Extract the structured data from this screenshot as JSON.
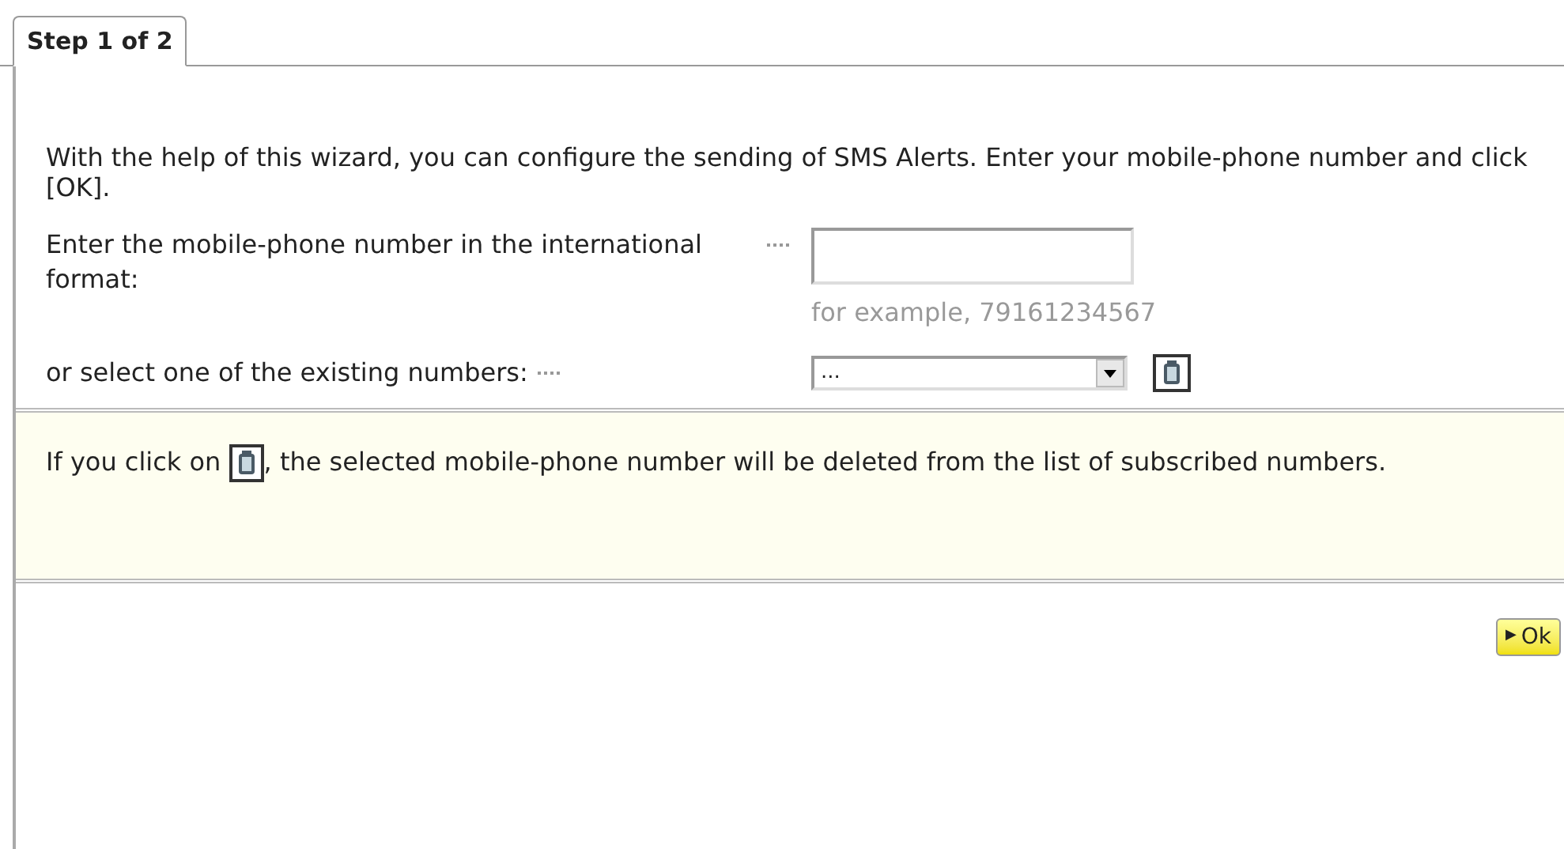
{
  "tab": {
    "label": "Step 1 of 2",
    "selected": true
  },
  "intro": "With the help of this wizard, you can configure the sending of SMS Alerts. Enter your mobile-phone number and click [OK].",
  "phone_field": {
    "label": "Enter the mobile-phone number in the international format:",
    "hint": "for example, 79161234567"
  },
  "existing_select": {
    "label": "or select one of the existing numbers:",
    "value": "..."
  },
  "note": {
    "before": "If you click on",
    "after": ", the selected mobile-phone number will be deleted from the list of subscribed numbers."
  },
  "ok_button": {
    "icon": "▶",
    "label": "Ok"
  }
}
